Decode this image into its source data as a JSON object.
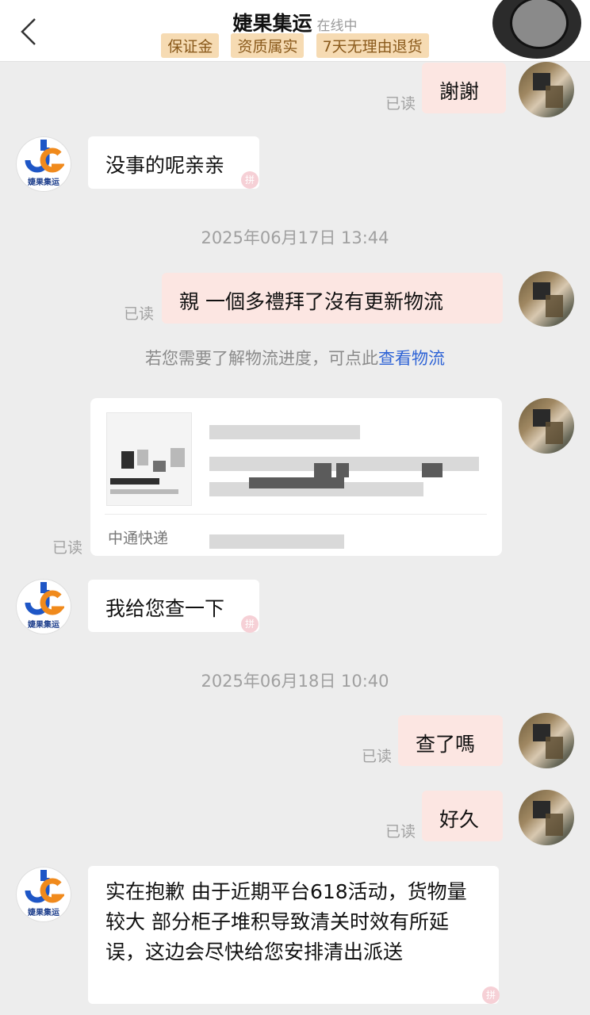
{
  "header": {
    "back_label": "返回",
    "title": "婕果集运",
    "status": "在线中",
    "badges": [
      "保证金",
      "资质属实",
      "7天无理由退货"
    ]
  },
  "shop": {
    "logo_text": "婕果集运"
  },
  "messages": [
    {
      "side": "right",
      "text": "謝謝",
      "read": "已读"
    },
    {
      "side": "left",
      "text": "没事的呢亲亲"
    },
    {
      "side": "right",
      "text": "親 一個多禮拜了沒有更新物流",
      "read": "已读"
    },
    {
      "side": "left",
      "text": "我给您查一下"
    },
    {
      "side": "right",
      "text": "查了嗎",
      "read": "已读"
    },
    {
      "side": "right",
      "text": "好久",
      "read": "已读"
    },
    {
      "side": "left",
      "text": "实在抱歉 由于近期平台618活动，货物量较大 部分柜子堆积导致清关时效有所延误，这边会尽快给您安排清出派送"
    }
  ],
  "timestamps": [
    "2025年06月17日 13:44",
    "2025年06月18日 10:40"
  ],
  "logistics_notice": {
    "prefix": "若您需要了解物流进度，可点此",
    "link": "查看物流"
  },
  "order_card": {
    "read": "已读",
    "carrier": "中通快递"
  },
  "colors": {
    "background": "#ededed",
    "bubble_left": "#ffffff",
    "bubble_right": "#fce6e2",
    "badge_bg": "#f6dbb3",
    "badge_text": "#8a5a1c",
    "link": "#2f64d6"
  }
}
